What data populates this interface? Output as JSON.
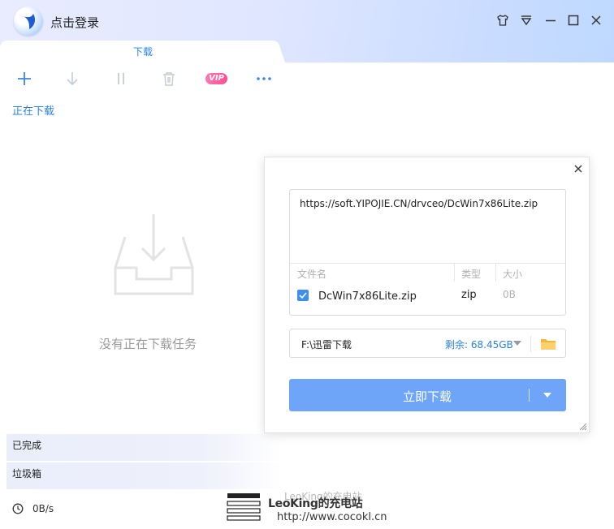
{
  "titlebar": {
    "login_label": "点击登录",
    "skin_icon": "tshirt-icon",
    "menu_icon": "dropdown-menu-icon",
    "minimize_icon": "minimize-icon",
    "maximize_icon": "maximize-icon",
    "close_icon": "close-icon"
  },
  "tab": {
    "label": "下载"
  },
  "toolbar": {
    "icons": [
      "plus-icon",
      "download-arrow-icon",
      "pause-icon",
      "trash-icon",
      "vip-badge",
      "more-icon"
    ],
    "vip_label": "VIP"
  },
  "sidebar": {
    "downloading_label": "正在下载",
    "empty_text": "没有正在下载任务",
    "completed_label": "已完成",
    "trash_label": "垃圾箱",
    "speed": "0B/s"
  },
  "watermark": {
    "line1": "LeoKing的充电站",
    "line2": "LeoKing的充电站",
    "url": "http://www.cocokl.cn"
  },
  "dialog": {
    "url": "https://soft.YIPOJIE.CN/drvceo/DcWin7x86Lite.zip",
    "columns": [
      "文件名",
      "类型",
      "大小"
    ],
    "file": {
      "name": "DcWin7x86Lite.zip",
      "type": "zip",
      "size": "0B",
      "checked": true
    },
    "save_path": "F:\\迅雷下载",
    "remaining": "剩余: 68.45GB",
    "download_button": "立即下载"
  },
  "colors": {
    "accent": "#2a82e4",
    "button": "#6ea5f8",
    "vip": "#ff5c9c",
    "folder": "#f5b53c"
  }
}
